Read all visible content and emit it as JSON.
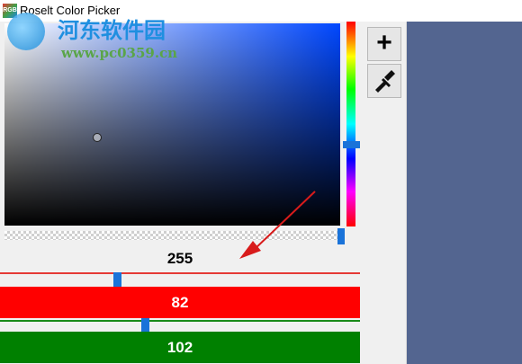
{
  "window": {
    "title": "Roselt Color Picker",
    "app_icon_text": "RGB"
  },
  "watermark": {
    "text": "河东软件园",
    "url": "www.pc0359.cn"
  },
  "picker": {
    "alpha_value": "255",
    "red_value": "82",
    "green_value": "102"
  },
  "toolbar": {
    "add_icon": "plus-icon",
    "picker_icon": "eyedropper-icon",
    "add_glyph": "+"
  },
  "colors": {
    "background": "#f0f0f0",
    "panel": "#536590",
    "red": "#ff0000",
    "green": "#008000",
    "slider_thumb": "#1a73d9"
  }
}
